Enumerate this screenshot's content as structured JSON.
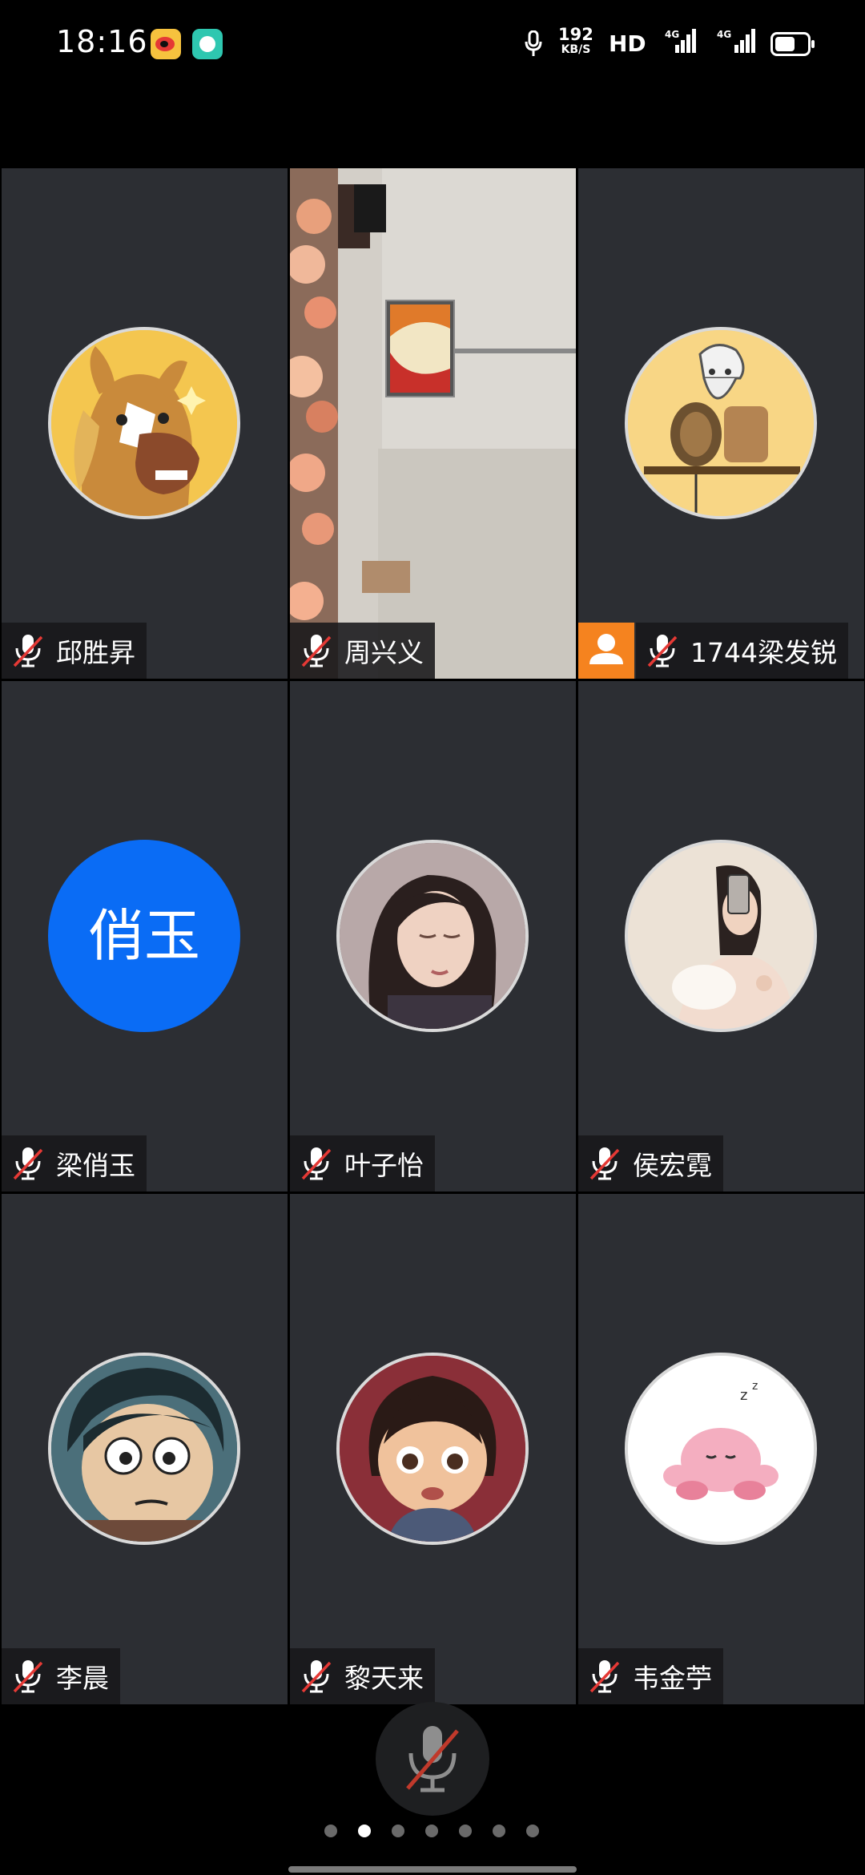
{
  "status_bar": {
    "time": "18:16",
    "speed_value": "192",
    "speed_unit": "KB/S",
    "hd_label": "HD",
    "network_1": "4G",
    "network_2": "4G",
    "icons": [
      "weibo-icon",
      "message-icon",
      "mic-icon",
      "signal-icon",
      "battery-icon"
    ]
  },
  "participants": [
    {
      "name": "邱胜昇",
      "avatar": "horse-cartoon",
      "muted": true
    },
    {
      "name": "周兴义",
      "avatar": "camera-video",
      "muted": true
    },
    {
      "name": "1744梁发锐",
      "avatar": "miner-cartoon",
      "muted": true,
      "host": true
    },
    {
      "name": "梁俏玉",
      "avatar_text": "俏玉",
      "muted": true
    },
    {
      "name": "叶子怡",
      "avatar": "woman-photo",
      "muted": true
    },
    {
      "name": "侯宏霓",
      "avatar": "mirror-selfie",
      "muted": true
    },
    {
      "name": "李晨",
      "avatar": "anime-boy",
      "muted": true
    },
    {
      "name": "黎天来",
      "avatar": "animated-girl",
      "muted": true
    },
    {
      "name": "韦金苧",
      "avatar": "pink-creature-sleeping",
      "muted": true
    }
  ],
  "controls": {
    "mic_muted": true
  },
  "pagination": {
    "total": 7,
    "current": 2
  },
  "colors": {
    "tile_bg": "#2c2e33",
    "avatar_blue": "#0a6cf5",
    "host_badge": "#f5831f",
    "mute_slash": "#e53935"
  }
}
